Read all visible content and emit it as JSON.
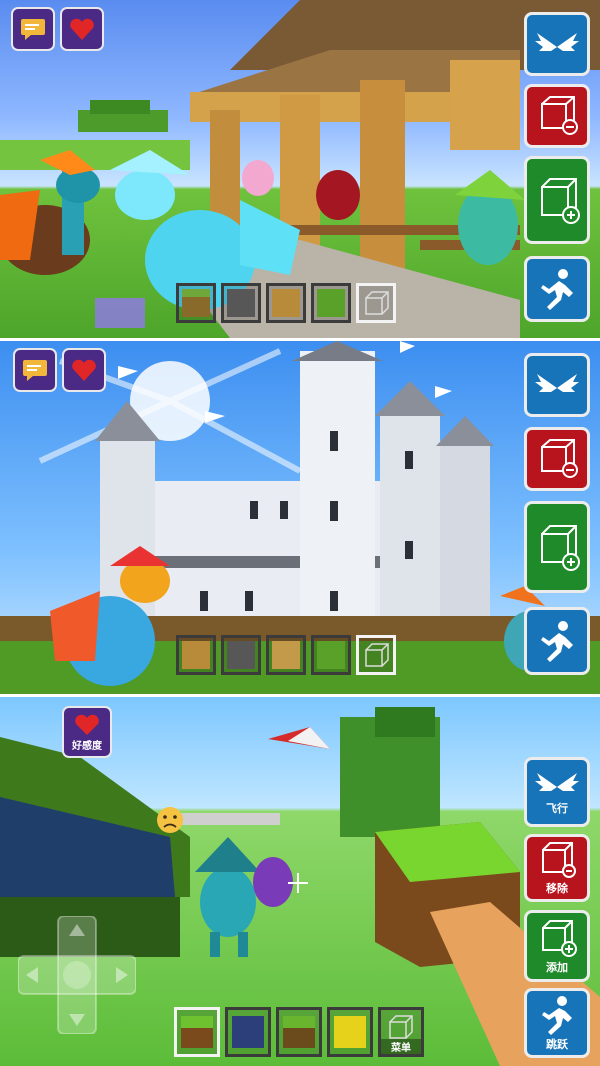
{
  "panels": [
    {
      "id": "top-panel",
      "top_buttons": [
        {
          "name": "chat-button",
          "icon": "chat-bubble-icon"
        },
        {
          "name": "affection-button",
          "icon": "heart-icon"
        }
      ],
      "side_buttons": [
        {
          "name": "fly-button",
          "icon": "wings-icon",
          "color": "#1774b8",
          "label": ""
        },
        {
          "name": "remove-block-button",
          "icon": "cube-minus-icon",
          "color": "#b8141d",
          "label": ""
        },
        {
          "name": "add-block-button",
          "icon": "cube-plus-icon",
          "color": "#1f8a2a",
          "label": ""
        },
        {
          "name": "jump-button",
          "icon": "running-person-icon",
          "color": "#1774b8",
          "label": ""
        }
      ],
      "hotbar": [
        "dirt",
        "stone",
        "wood",
        "grass",
        "empty"
      ]
    },
    {
      "id": "middle-panel",
      "top_buttons": [
        {
          "name": "chat-button",
          "icon": "chat-bubble-icon"
        },
        {
          "name": "affection-button",
          "icon": "heart-icon"
        }
      ],
      "side_buttons": [
        {
          "name": "fly-button",
          "icon": "wings-icon",
          "color": "#1774b8",
          "label": ""
        },
        {
          "name": "remove-block-button",
          "icon": "cube-minus-icon",
          "color": "#b8141d",
          "label": ""
        },
        {
          "name": "add-block-button",
          "icon": "cube-plus-icon",
          "color": "#1f8a2a",
          "label": ""
        },
        {
          "name": "jump-button",
          "icon": "running-person-icon",
          "color": "#1774b8",
          "label": ""
        }
      ],
      "hotbar": [
        "wood",
        "stone",
        "wood",
        "grass",
        "empty"
      ]
    },
    {
      "id": "bottom-panel",
      "affection_label": "好感度",
      "side_buttons": [
        {
          "name": "fly-button",
          "icon": "wings-icon",
          "color": "#1774b8",
          "label": "飞行"
        },
        {
          "name": "remove-block-button",
          "icon": "cube-minus-icon",
          "color": "#b8141d",
          "label": "移除"
        },
        {
          "name": "add-block-button",
          "icon": "cube-plus-icon",
          "color": "#1f8a2a",
          "label": "添加"
        },
        {
          "name": "jump-button",
          "icon": "running-person-icon",
          "color": "#1774b8",
          "label": "跳跃"
        }
      ],
      "hotbar": [
        "grass",
        "blue-stone",
        "mossy",
        "gold",
        "empty"
      ],
      "menu_label": "菜单"
    }
  ],
  "colors": {
    "dirt": "#8a6a2a",
    "stone": "#575757",
    "wood": "#b88b3b",
    "grass": "#5aa12a",
    "gold": "#e6d21a",
    "blue-stone": "#2c3f7a",
    "mossy": "#6ab52e"
  }
}
